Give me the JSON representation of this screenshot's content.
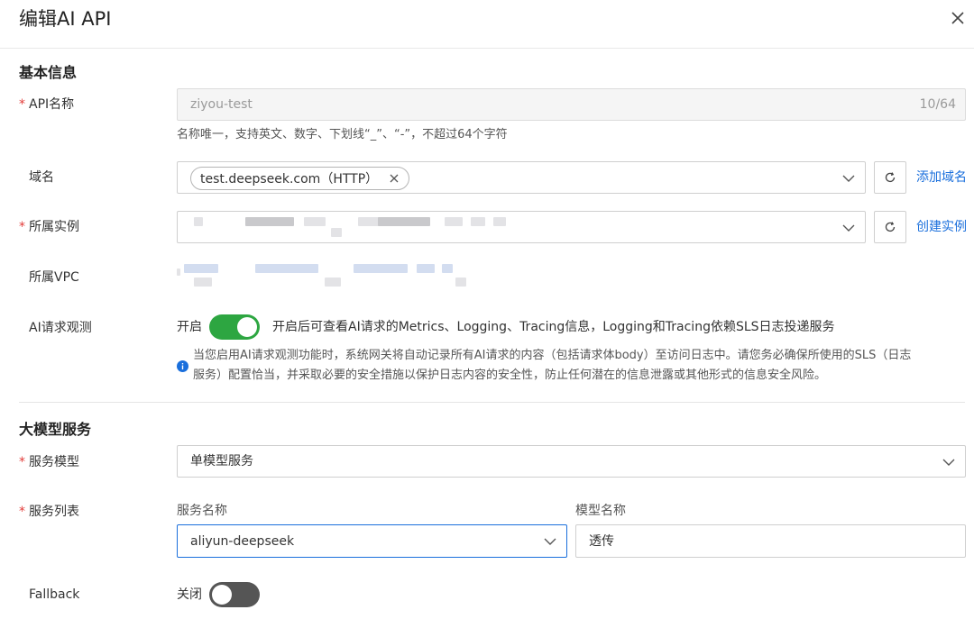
{
  "dialog": {
    "title": "编辑AI API"
  },
  "basic": {
    "section_title": "基本信息",
    "api_name": {
      "required_mark": "*",
      "label": "API名称",
      "value": "ziyou-test",
      "counter": "10/64",
      "hint": "名称唯一，支持英文、数字、下划线“_”、“-”，不超过64个字符"
    },
    "domain": {
      "label": "域名",
      "tag": "test.deepseek.com（HTTP）",
      "add_link": "添加域名"
    },
    "instance": {
      "required_mark": "*",
      "label": "所属实例",
      "create_link": "创建实例"
    },
    "vpc": {
      "label": "所属VPC"
    },
    "observe": {
      "label": "AI请求观测",
      "state_label": "开启",
      "enabled": true,
      "description": "开启后可查看AI请求的Metrics、Logging、Tracing信息，Logging和Tracing依赖SLS日志投递服务",
      "notice_line1": "当您启用AI请求观测功能时，系统网关将自动记录所有AI请求的内容（包括请求体body）至访问日志中。请您务必确保所使用的SLS（日志",
      "notice_line2": "服务）配置恰当，并采取必要的安全措施以保护日志内容的安全性，防止任何潜在的信息泄露或其他形式的信息安全风险。"
    }
  },
  "model_service": {
    "section_title": "大模型服务",
    "service_model": {
      "required_mark": "*",
      "label": "服务模型",
      "value": "单模型服务"
    },
    "service_list": {
      "required_mark": "*",
      "label": "服务列表",
      "col_service_name": "服务名称",
      "col_model_name": "模型名称",
      "service_value": "aliyun-deepseek",
      "model_value": "透传"
    },
    "fallback": {
      "label": "Fallback",
      "state_label": "关闭",
      "enabled": false
    }
  },
  "colors": {
    "accent": "#1a6fdc",
    "toggle_on": "#2da641",
    "required": "#e23c39"
  }
}
